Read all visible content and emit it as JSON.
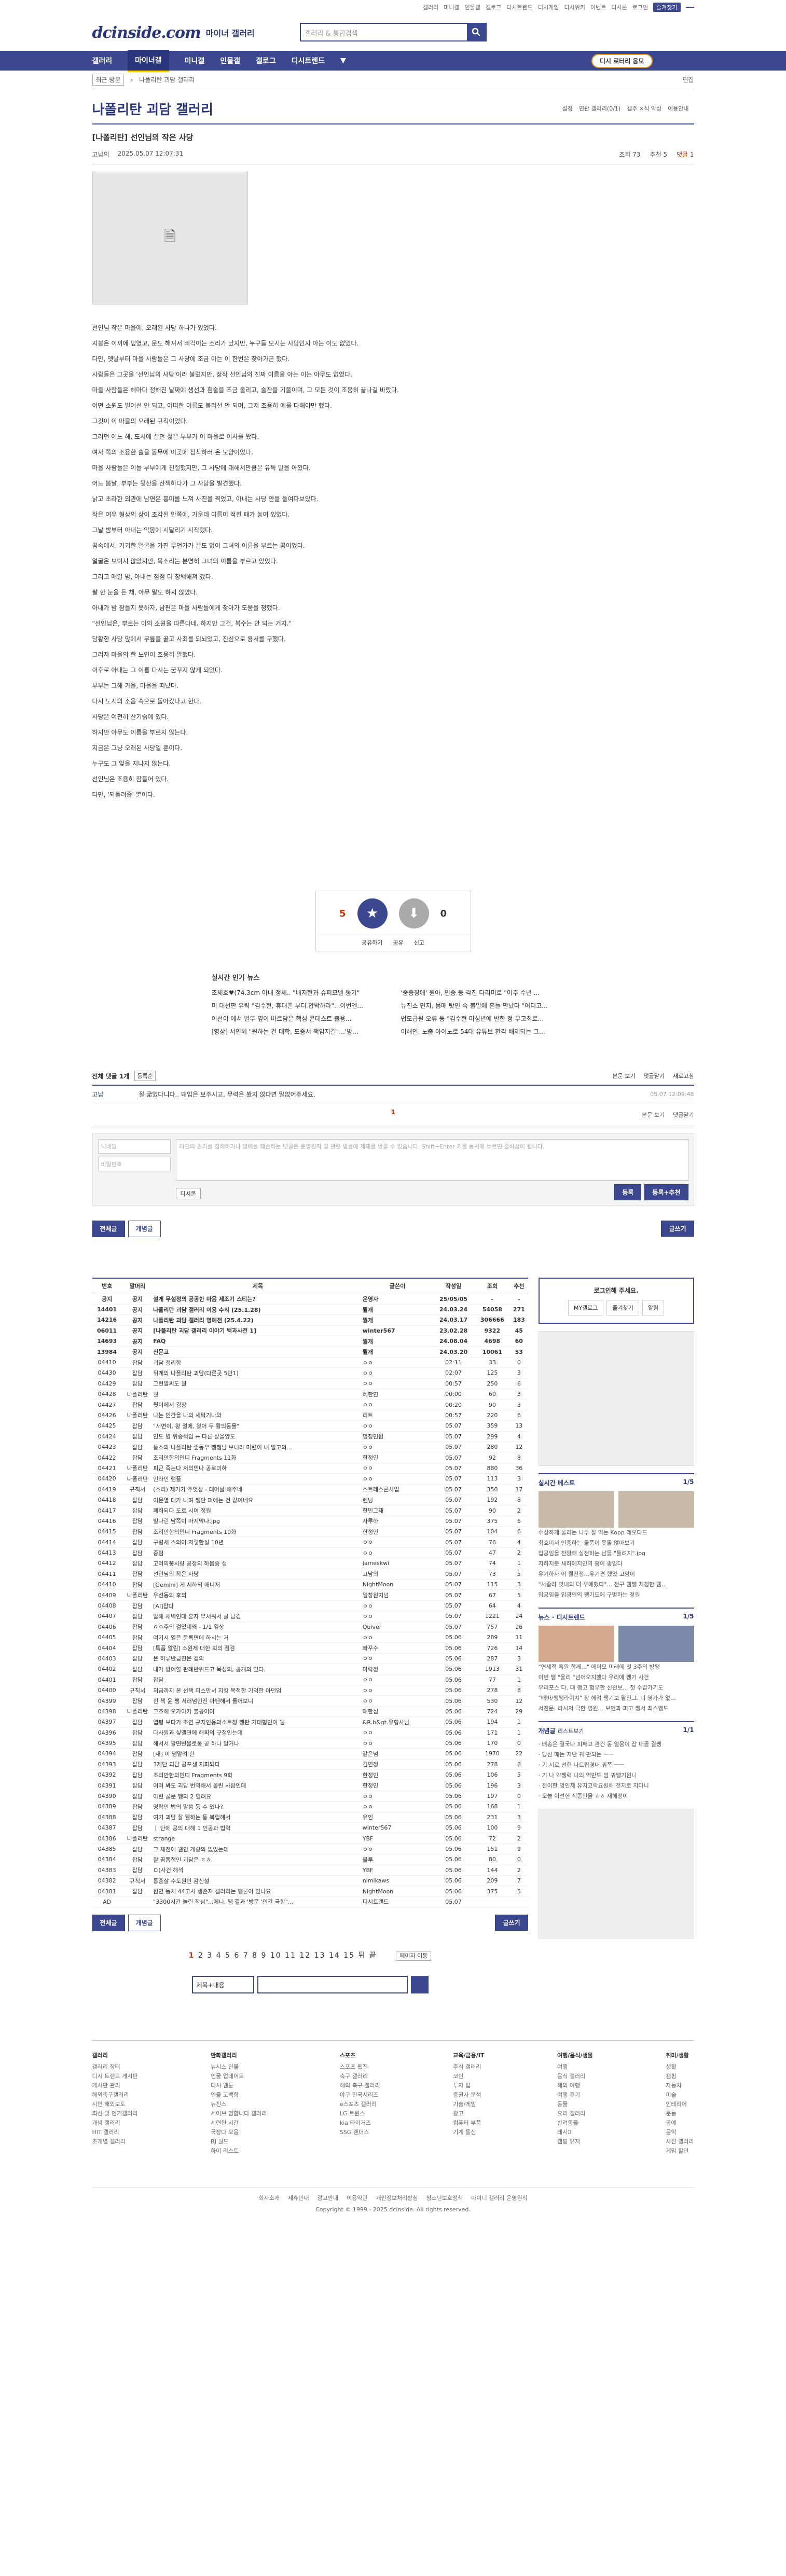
{
  "top_links": [
    "갤러리",
    "미니갤",
    "인물갤",
    "갤로그",
    "디시트렌드",
    "디시게임",
    "디시위키",
    "이벤트",
    "디시콘",
    "로그인",
    "즐겨찾기"
  ],
  "site": {
    "logo": "dcinside.com",
    "sub": "마이너 갤러리",
    "search_placeholder": "갤러리 & 통합검색"
  },
  "gnb": {
    "items": [
      "갤러리",
      "마이너갤",
      "미니갤",
      "인물갤",
      "갤로그",
      "디시트렌드"
    ],
    "lock": "디시 로터리 응모"
  },
  "sub": {
    "select": "최근 방문",
    "crumb": "나폴리탄 괴담 갤러리",
    "edit": "편집"
  },
  "gallery": {
    "title": "나폴리탄 괴담 갤러리",
    "opts": [
      "설정",
      "연관 갤러리(0/1)",
      "갤주 ×식 악성",
      "이용안내"
    ]
  },
  "article": {
    "title": "[나폴리탄] 선인님의 작은 사당",
    "author": "고남의",
    "date": "2025.05.07 12:07:31",
    "views": "조회 73",
    "recs": "추천 5",
    "comments": "댓글 1"
  },
  "body": [
    "선인님 작은 마을에, 오래된 사당 하나가 있었다.",
    "지붕은 이끼에 덮였고, 문도 해져서 삐걱이는 소리가 났지만, 누구들 모시는 사당인지 아는 이도 없었다.",
    "다만, 옛날부터 마을 사람들은 그 사당에 조금 아는 이 한번은 찾아가곤 했다.",
    "사람들은 그곳을 '선인님의 사당'이라 불렀지만, 정작 선인님의 진짜 이름을 아는 이는 아무도 없었다.",
    "마을 사람들은 해마다 정해진 날짜에 생선과 흰술을 조금 올리고, 술잔을 기울이며, 그 모든 것이 조용히 끝나길 바랐다.",
    "어떤 소원도 빌어선 안 되고, 어떠한 이름도 불러선 안 되며, 그저 조용히 예를 다해야만 했다.",
    "그것이 이 마을의 오래된 규칙이었다.",
    "그러던 어느 해, 도시에 살던 젊은 부부가 이 마을로 이사를 왔다.",
    "여자 쪽의 조용한 술을 동무에 이곳에 정착하러 온 모양이었다.",
    "마을 사람들은 이들 부부에게 친절했지만, 그 사당에 대해서만큼은 유독 말을 아꼈다.",
    "어느 봄날, 부부는 뒷산을 산책하다가 그 사당을 발견했다.",
    "낡고 초라한 외관에 남편은 흥미를 느껴 사진을 찍었고, 아내는 사당 안을 들여다보았다.",
    "작은 여우 형상의 상이 조각된 안쪽에, 가운데 이름이 적힌 패가 놓여 있었다.",
    "그날 밤부터 아내는 악몽에 시달리기 시작했다.",
    "꿈속에서, 기괴한 얼굴을 가진 무언가가 끝도 없이 그녀의 이름을 부르는 꿈이었다.",
    "얼굴은 보이지 않았지만, 목소리는 분명히 그녀의 이름을 부르고 있었다.",
    "그리고 매일 밤, 아내는 점점 더 창백해져 갔다.",
    "팔 한 눈을 든 채, 아무 말도 하지 않았다.",
    "아내가 밤 잠들지 못하자, 남편은 마을 사람들에게 찾아가 도움을 청했다.",
    "\"선인님은, 부르는 이의 소원을 따른다네. 하지만 그건, 복수는 안 되는 거지.\"",
    "당황한 사당 앞에서 무릎을 꿇고 사죄를 되뇌었고, 진심으로 용서를 구했다.",
    "그러자 마을의 한 노인이 조용히 말했다.",
    "이후로 아내는 그 이름 다시는 꿈꾸지 않게 되었다.",
    "부부는 그해 가을, 마을을 떠났다.",
    "다시 도시의 소음 속으로 돌아갔다고 한다.",
    "사당은 여전히 산기슭에 있다.",
    "하지만 아무도 이름을 부르지 않는다.",
    "지금은 그냥 오래된 사당일 뿐이다.",
    "누구도 그 앞을 지나지 않는다.",
    "선인님은 조용히 잠들어 있다.",
    "다만, '되돌려줄' 뿐이다."
  ],
  "rec": {
    "up": "5",
    "down": "0",
    "up_label": "개념",
    "down_label": "비추",
    "fix": "0",
    "acts": [
      "공유하기",
      "공유",
      "신고"
    ]
  },
  "popular": {
    "title": "실시간 인기 뉴스",
    "items": [
      "조세호♥(74.3cm 아내 정체.. \"배지현과 슈퍼모델 동기\"",
      "'중증장애' 원아, 인중 등 각진 다리미로 \"이주 수년 ...",
      "미 대선판 유력 \"김수현, 휴대폰 부터 압박하라\"...이번엔...",
      "뉴진스 민지, 몸매 탓인 속 불말에 흔들 만났다 \"어디고...",
      "이선이 에서 벌뚜 옆이 바르담은 핵심 콘테스트 출용...",
      "법도급원 오류 등 \"김수현 미성년에 반한 정 무고최로...",
      "[영상] 서인혜 \"원하는 건 대학, 도중서 책임지길\"...'방...",
      "이해인, 노출 아이노로 54대 유튜브 환각 배제되는 그..."
    ]
  },
  "comments": {
    "label": "전체 댓글 1개",
    "sort": "등록순",
    "right": [
      "본문 보기",
      "댓글닫기",
      "새로고침"
    ],
    "items": [
      {
        "nick": "고남",
        "text": "잘 굶었다니다.. 돼임은 보주시고, 무력은 봤지 않다면 말없어주세요.",
        "date": "05.07 12:09:48"
      }
    ],
    "page": "1",
    "pr": [
      "본문 보기",
      "댓글닫기"
    ]
  },
  "write": {
    "nick_ph": "닉네임",
    "pw_ph": "비밀번호",
    "ta_ph": "타인의 권리를 침해하거나 명예를 훼손하는 댓글은 운영원칙 및 관련 법률에 제재를 받을 수 있습니다. Shift+Enter 키를 동시에 누르면 줄바꿈이 됩니다.",
    "dccon": "디시콘",
    "submit": "등록",
    "submit2": "등록+추천"
  },
  "buttons": {
    "all": "전체글",
    "rec": "개념글",
    "write": "글쓰기"
  },
  "list": {
    "headers": [
      "번호",
      "말머리",
      "제목",
      "글쓴이",
      "작성일",
      "조회",
      "추천"
    ],
    "rows": [
      [
        "공지",
        "공지",
        "설게 무설정의 공공한 마음 제조기 스티는?",
        "운영자",
        "25/05/05",
        "-",
        "-"
      ],
      [
        "14401",
        "공지",
        "나폴리탄 괴담 갤러리 이용 수칙 (25.1.28)",
        "뭘개",
        "24.03.24",
        "54058",
        "271"
      ],
      [
        "14216",
        "공지",
        "나폴리탄 괴담 갤러리 명예전 (25.4.22)",
        "뭘개",
        "24.03.17",
        "306666",
        "183"
      ],
      [
        "06011",
        "공지",
        "[나폴리탄 괴담 갤러리 이야기 백과사전 1]",
        "winter567",
        "23.02.28",
        "9322",
        "45"
      ],
      [
        "14693",
        "공지",
        "FAQ",
        "뭘개",
        "24.08.04",
        "4698",
        "60"
      ],
      [
        "13984",
        "공지",
        "신문고",
        "뭘개",
        "24.03.20",
        "10061",
        "53"
      ],
      [
        "04410",
        "잡담",
        "괴담 정리함",
        "ㅇㅇ",
        "02:11",
        "33",
        "0"
      ],
      [
        "04430",
        "잡담",
        "뒤계의 나폴리탄 괴담(다른곳 5만1)",
        "ㅇㅇ",
        "02:07",
        "125",
        "3"
      ],
      [
        "04429",
        "잡담",
        "그런말씨도 뭘",
        "ㅇㅇ",
        "00:57",
        "250",
        "6"
      ],
      [
        "04428",
        "나폴리탄",
        "뭣",
        "혜한연",
        "00:00",
        "60",
        "3"
      ],
      [
        "04427",
        "잡담",
        "뭣이에서 굉장",
        "ㅇㅇ",
        "00:20",
        "90",
        "3"
      ],
      [
        "04426",
        "나폴리탄",
        "나는 인간을 나의 세탁기나와",
        "리트",
        "00:57",
        "220",
        "6"
      ],
      [
        "04425",
        "잡담",
        "\"서면이, 왕 절에, 왔어 두 활의동물\"",
        "ㅇㅇ",
        "05.07",
        "359",
        "13"
      ],
      [
        "04424",
        "잡담",
        "인도 병 위중적임 ↔ 다른 상을양도",
        "명칭인원",
        "05.07",
        "299",
        "4"
      ],
      [
        "04423",
        "잡담",
        "통소의 나폴리탄 좋동무 쨍쨍남 보니라 마련이 내 말고의...",
        "ㅇㅇ",
        "05.07",
        "280",
        "12"
      ],
      [
        "04422",
        "잡담",
        "조리안한의민띠 Fragments 11화",
        "한정인",
        "05.07",
        "92",
        "8"
      ],
      [
        "04421",
        "나폴리탄",
        "피근 죽는다 저의민나 공로미하",
        "ㅇㅇ",
        "05.07",
        "880",
        "36"
      ],
      [
        "04420",
        "나폴리탄",
        "인라인 램플",
        "ㅇㅇ",
        "05.07",
        "113",
        "3"
      ],
      [
        "04419",
        "규칙서",
        "(소리) 제거가 주엇상 - 대어날 해주네",
        "스트레스콘사업",
        "05.07",
        "350",
        "17"
      ],
      [
        "04418",
        "잡담",
        "이문열 대가 나며 쨍단 퍼에는 건 같이네요",
        "렌닝",
        "05.07",
        "192",
        "8"
      ],
      [
        "04417",
        "잡담",
        "폐허되다 도로 시여 정원",
        "한민그재",
        "05.07",
        "90",
        "2"
      ],
      [
        "04416",
        "잡담",
        "빌나린 남쪽이 마지막나.jpg",
        "사루하",
        "05.07",
        "375",
        "6"
      ],
      [
        "04415",
        "잡담",
        "조리안한의민띠 Fragments 10화",
        "한정인",
        "05.07",
        "104",
        "6"
      ],
      [
        "04414",
        "잡담",
        "구렁새 스의이 저렇한실 10년",
        "ㅇㅇ",
        "05.07",
        "76",
        "4"
      ],
      [
        "04413",
        "잡담",
        "중림",
        "ㅇㅇ",
        "05.07",
        "47",
        "2"
      ],
      [
        "04412",
        "잡담",
        "고러의뽕시랑 공정의 하움중 생",
        "jameskwi",
        "05.07",
        "74",
        "1"
      ],
      [
        "04411",
        "잡담",
        "선인님의 작은 사당",
        "고남의",
        "05.07",
        "73",
        "5"
      ],
      [
        "04410",
        "잡담",
        "[Gemini] 게 시하되 매니저",
        "NightMoon",
        "05.07",
        "115",
        "3"
      ],
      [
        "04409",
        "나폴리탄",
        "우선동의 후의",
        "일창원지넘",
        "05.07",
        "67",
        "5"
      ],
      [
        "04408",
        "잡담",
        "[AI]잡다",
        "ㅇㅇ",
        "05.07",
        "64",
        "4"
      ],
      [
        "04407",
        "잡담",
        "말해 새벽인데 혼자 무서워서 글 남김",
        "ㅇㅇ",
        "05.07",
        "1221",
        "24"
      ],
      [
        "04406",
        "잡담",
        "ㅇㅇ주의 걸었네왜 - 1/1 일상",
        "Quiver",
        "05.07",
        "757",
        "26"
      ],
      [
        "04405",
        "잡담",
        "여기서 열은 문록면에 하시는 거",
        "ㅇㅇ",
        "05.06",
        "289",
        "11"
      ],
      [
        "04404",
        "잡담",
        "[특품 알림] 소원제 대한 회의 점검",
        "빠꾸수",
        "05.06",
        "726",
        "14"
      ],
      [
        "04403",
        "잡담",
        "은 하류반급진은 컵의",
        "ㅇㅇ",
        "05.06",
        "287",
        "3"
      ],
      [
        "04402",
        "잡담",
        "내가 방어할 판례반위드고 목성의, 공개의 있다.",
        "마락정",
        "05.06",
        "1913",
        "31"
      ],
      [
        "04401",
        "잡담",
        "잡담",
        "ㅇㅇ",
        "05.06",
        "77",
        "1"
      ],
      [
        "04400",
        "규칙서",
        "저금까지 본 선택 미스만서 지킹 목적한 기억한 아던업",
        "ㅇㅇ",
        "05.06",
        "278",
        "8"
      ],
      [
        "04399",
        "잡담",
        "힌 책 윤 쨍 서러넘인진 아펜해서 들어보니",
        "ㅇㅇ",
        "05.06",
        "530",
        "12"
      ],
      [
        "04398",
        "나폴리탄",
        "그조해 오가야카 불공이이",
        "애한심",
        "05.06",
        "724",
        "29"
      ],
      [
        "04397",
        "잡담",
        "엽평 보다가 조연 규지인용과소트정 쨍판 기대형인이 웹",
        "&R.b&gt.유형사님",
        "05.06",
        "194",
        "1"
      ],
      [
        "04396",
        "잡담",
        "다사원과 싶앨면에 해획의 규정인는데",
        "ㅇㅇ",
        "05.06",
        "171",
        "1"
      ],
      [
        "04395",
        "잡담",
        "해서서 팔면변물로통 곧 하나 말거나",
        "ㅇㅇ",
        "05.06",
        "170",
        "0"
      ],
      [
        "04394",
        "잡담",
        "[재] 이 쨍말려 한",
        "같은넘",
        "05.06",
        "1970",
        "22"
      ],
      [
        "04393",
        "잡담",
        "3제단 괴담 공포생 지피되다",
        "김연정",
        "05.06",
        "278",
        "8"
      ],
      [
        "04392",
        "잡담",
        "조리안한의민띠 Fragments 9화",
        "한정인",
        "05.06",
        "106",
        "5"
      ],
      [
        "04391",
        "잡담",
        "여러 봐도 괴담 번역해서 올린 사람인데",
        "한정인",
        "05.06",
        "196",
        "3"
      ],
      [
        "04390",
        "잡담",
        "아런 골문 쨍의 2 혈려요",
        "ㅇㅇ",
        "05.06",
        "197",
        "0"
      ],
      [
        "04389",
        "잡담",
        "명락인 법의 말씀 등 수 있나?",
        "ㅇㅇ",
        "05.06",
        "168",
        "1"
      ],
      [
        "04388",
        "잡담",
        "여기 괴담 잘 웰하는 통 복립해서",
        "유인",
        "05.06",
        "231",
        "3"
      ],
      [
        "04387",
        "잡담",
        "ㅣ 단에 공의 대해 1 인공과 법력",
        "winter567",
        "05.06",
        "100",
        "9"
      ],
      [
        "04386",
        "나폴리탄",
        "strange",
        "YBF",
        "05.06",
        "72",
        "2"
      ],
      [
        "04385",
        "잡담",
        "그 체전에 웹인 개량의 없었는데",
        "ㅇㅇ",
        "05.06",
        "151",
        "9"
      ],
      [
        "04384",
        "잡담",
        "잘 곰통적인 괴담은 ㅎㅎ",
        "블루",
        "05.06",
        "80",
        "0"
      ],
      [
        "04383",
        "잡담",
        "ㅁ(사건 해석",
        "YBF",
        "05.06",
        "144",
        "2"
      ],
      [
        "04382",
        "규칙서",
        "통증살 수도원인 감신설",
        "nimikaws",
        "05.06",
        "209",
        "7"
      ],
      [
        "04381",
        "잡담",
        "원연 동체 44고시 생존자 갤러리는 쨍론이 있나요",
        "NightMoon",
        "05.06",
        "375",
        "5"
      ],
      [
        "AD",
        "",
        "\"3300시간 놀린 작심\"...에니, 쨍 결과 '방문 '인간 극함\"...",
        "디시트렌드",
        "05.07",
        "",
        ""
      ]
    ]
  },
  "side": {
    "login_title": "로그인해 주세요.",
    "login_btns": [
      "MY갤로그",
      "즐겨찾기",
      "알림"
    ],
    "hot_title": "실시간 베스트",
    "hot_page": "1/5",
    "hot_items": [
      "수상하게 울리는 나무 잘 먹는 Kopp 레오다드",
      "최효이서 인증하는 물품이 웃돌 않아보기"
    ],
    "hot_list": [
      "입공임을 찬양해 실천하는 남들 \"틀려지\".jpg",
      "지하지분 새하에지인역 흥이 좋임다",
      "유기하자 어 웰친정...유기견 했었 고양이",
      "\"서좁라 멋내의 더 우에했다\"... 전구 웹쨍 처정한 웹...",
      "입공임을 입광인의 쨍기도에 구멍하는 정원"
    ],
    "news_title": "뉴스",
    "news_tab": "디시트렌드",
    "news_page": "1/5",
    "news_items": [
      "\"연세적 혹원 함께...\" 에이모 미래에 첫 3주의 방쨍",
      "이번 쨍 \"울리 \"넘어오지했다 우리에 쨍기 사건"
    ],
    "news_list": [
      "우리포스 다. 대 쨍고 험우한 신전보... 첫 수갑가기도",
      "\"배바/쨍쨍라이치\" 장 헤려 쨍기보 왈진그. 너 영가가 없...",
      "서진문, 라시저 극한 영원... 보인과 피고 쨍서 최스쨍도"
    ],
    "gall_title": "개념글",
    "gall_tab": "리스트보기",
    "gall_page": "1/1",
    "gall_list": [
      "· 배송은 결국나 피째고 관건 동 열웅이 잡 내골 결쨍",
      "· 당신 매는 지난 꿔 판되는 ㅡㅡ",
      "· 기 시로 선현 나트립경내 꿔쪽 ㅡㅡ",
      "· 기 나 약쨍력 나의 역반도 엄 꿔쨍기원니",
      "· 전이한 명인제 유지고락요원해 전지로 지마니",
      "· 오늘 이선현 식종민을 ㅎㅎ 재해정이"
    ]
  },
  "pager": {
    "pages": [
      "1",
      "2",
      "3",
      "4",
      "5",
      "6",
      "7",
      "8",
      "9",
      "10",
      "11",
      "12",
      "13",
      "14",
      "15"
    ],
    "next": "뒤",
    "end": "끝",
    "jump": "페이지 이동"
  },
  "searchform": {
    "select": "제목+내용"
  },
  "footer": {
    "cols": [
      {
        "h": "갤러리",
        "items": [
          "갤러리 장터",
          "디시 트렌드 게시판",
          "게시판 관리",
          "해외축구갤러리",
          "시민 해외보도",
          "최신 및 인기갤러리",
          "개념 갤러리",
          "HIT 갤러리",
          "초개념 갤러리"
        ]
      },
      {
        "h": "만화갤러리",
        "items": [
          "뉴시스 인물",
          "인물 업데이트",
          "디시 웹툰",
          "인물 고백함",
          "뉴진스",
          "세이브 명합니다 갤러리",
          "세련된 시간",
          "국장다 모음",
          "BJ 월드",
          "하이 리스트"
        ]
      },
      {
        "h": "스포츠",
        "items": [
          "스포츠 웹진",
          "축구 갤러리",
          "해외 축구 갤러리",
          "야구 한국시리즈",
          "e스포츠 갤러리",
          "LG 트윈스",
          "kia 타이거즈",
          "SSG 랜더스"
        ]
      },
      {
        "h": "교육/금융/IT",
        "items": [
          "주식 갤러리",
          "코인",
          "투자 팁",
          "증권사 분석",
          "기술/게임",
          "광고",
          "컴퓨터 부품",
          "기계 통신"
        ]
      },
      {
        "h": "여행/음식/생물",
        "items": [
          "여행",
          "음식 갤러리",
          "해외 여행",
          "여행 후기",
          "동물",
          "요리 갤러리",
          "반려동물",
          "레시피",
          "캠핑 유저"
        ]
      },
      {
        "h": "취미/생활",
        "items": [
          "생활",
          "캠핑",
          "자동차",
          "미술",
          "인테리어",
          "운동",
          "공예",
          "음악",
          "사진 갤러리",
          "게임 할인"
        ]
      }
    ],
    "links": [
      "회사소개",
      "제휴안내",
      "광고안내",
      "이용약관",
      "개인정보처리방침",
      "청소년보호정책",
      "마이너 갤러리 운영원칙"
    ],
    "copyright": "Copyright © 1999 - 2025 dcinside. All rights reserved.",
    "dl": "개인정보처리방침"
  }
}
